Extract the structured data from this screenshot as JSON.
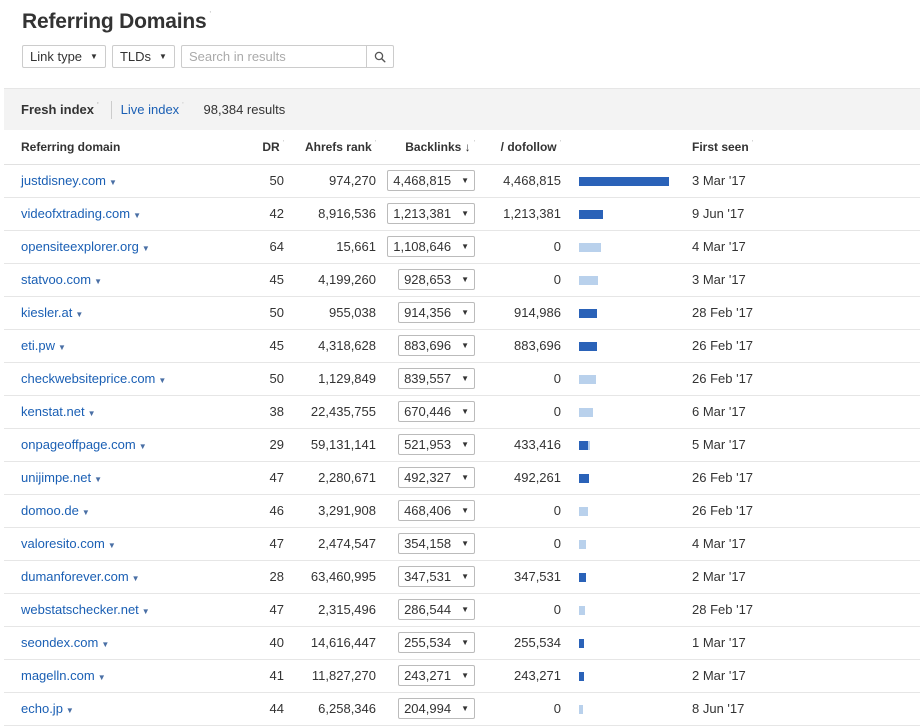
{
  "header": {
    "title": "Referring Domains"
  },
  "filters": {
    "link_type": "Link type",
    "tlds": "TLDs",
    "search_placeholder": "Search in results"
  },
  "index": {
    "fresh": "Fresh index",
    "live": "Live index",
    "results": "98,384 results"
  },
  "columns": {
    "domain": "Referring domain",
    "dr": "DR",
    "rank": "Ahrefs rank",
    "backlinks": "Backlinks",
    "sort_arrow": "↓",
    "dofollow": "/ dofollow",
    "first_seen": "First seen"
  },
  "colors": {
    "link": "#1a5fb4",
    "bar_dofollow": "#2a62b8",
    "bar_total": "#b9d1ec"
  },
  "rows": [
    {
      "domain": "justdisney.com",
      "dr": "50",
      "rank": "974,270",
      "backlinks": "4,468,815",
      "dofollow": "4,468,815",
      "bl_value": 4468815,
      "df_value": 4468815,
      "first_seen": "3 Mar '17"
    },
    {
      "domain": "videofxtrading.com",
      "dr": "42",
      "rank": "8,916,536",
      "backlinks": "1,213,381",
      "dofollow": "1,213,381",
      "bl_value": 1213381,
      "df_value": 1213381,
      "first_seen": "9 Jun '17"
    },
    {
      "domain": "opensiteexplorer.org",
      "dr": "64",
      "rank": "15,661",
      "backlinks": "1,108,646",
      "dofollow": "0",
      "bl_value": 1108646,
      "df_value": 0,
      "first_seen": "4 Mar '17"
    },
    {
      "domain": "statvoo.com",
      "dr": "45",
      "rank": "4,199,260",
      "backlinks": "928,653",
      "dofollow": "0",
      "bl_value": 928653,
      "df_value": 0,
      "first_seen": "3 Mar '17"
    },
    {
      "domain": "kiesler.at",
      "dr": "50",
      "rank": "955,038",
      "backlinks": "914,356",
      "dofollow": "914,986",
      "bl_value": 914356,
      "df_value": 914356,
      "first_seen": "28 Feb '17"
    },
    {
      "domain": "eti.pw",
      "dr": "45",
      "rank": "4,318,628",
      "backlinks": "883,696",
      "dofollow": "883,696",
      "bl_value": 883696,
      "df_value": 883696,
      "first_seen": "26 Feb '17"
    },
    {
      "domain": "checkwebsiteprice.com",
      "dr": "50",
      "rank": "1,129,849",
      "backlinks": "839,557",
      "dofollow": "0",
      "bl_value": 839557,
      "df_value": 0,
      "first_seen": "26 Feb '17"
    },
    {
      "domain": "kenstat.net",
      "dr": "38",
      "rank": "22,435,755",
      "backlinks": "670,446",
      "dofollow": "0",
      "bl_value": 670446,
      "df_value": 0,
      "first_seen": "6 Mar '17"
    },
    {
      "domain": "onpageoffpage.com",
      "dr": "29",
      "rank": "59,131,141",
      "backlinks": "521,953",
      "dofollow": "433,416",
      "bl_value": 521953,
      "df_value": 433416,
      "first_seen": "5 Mar '17"
    },
    {
      "domain": "unijimpe.net",
      "dr": "47",
      "rank": "2,280,671",
      "backlinks": "492,327",
      "dofollow": "492,261",
      "bl_value": 492327,
      "df_value": 492261,
      "first_seen": "26 Feb '17"
    },
    {
      "domain": "domoo.de",
      "dr": "46",
      "rank": "3,291,908",
      "backlinks": "468,406",
      "dofollow": "0",
      "bl_value": 468406,
      "df_value": 0,
      "first_seen": "26 Feb '17"
    },
    {
      "domain": "valoresito.com",
      "dr": "47",
      "rank": "2,474,547",
      "backlinks": "354,158",
      "dofollow": "0",
      "bl_value": 354158,
      "df_value": 0,
      "first_seen": "4 Mar '17"
    },
    {
      "domain": "dumanforever.com",
      "dr": "28",
      "rank": "63,460,995",
      "backlinks": "347,531",
      "dofollow": "347,531",
      "bl_value": 347531,
      "df_value": 347531,
      "first_seen": "2 Mar '17"
    },
    {
      "domain": "webstatschecker.net",
      "dr": "47",
      "rank": "2,315,496",
      "backlinks": "286,544",
      "dofollow": "0",
      "bl_value": 286544,
      "df_value": 0,
      "first_seen": "28 Feb '17"
    },
    {
      "domain": "seondex.com",
      "dr": "40",
      "rank": "14,616,447",
      "backlinks": "255,534",
      "dofollow": "255,534",
      "bl_value": 255534,
      "df_value": 255534,
      "first_seen": "1 Mar '17"
    },
    {
      "domain": "magelln.com",
      "dr": "41",
      "rank": "11,827,270",
      "backlinks": "243,271",
      "dofollow": "243,271",
      "bl_value": 243271,
      "df_value": 243271,
      "first_seen": "2 Mar '17"
    },
    {
      "domain": "echo.jp",
      "dr": "44",
      "rank": "6,258,346",
      "backlinks": "204,994",
      "dofollow": "0",
      "bl_value": 204994,
      "df_value": 0,
      "first_seen": "8 Jun '17"
    }
  ]
}
